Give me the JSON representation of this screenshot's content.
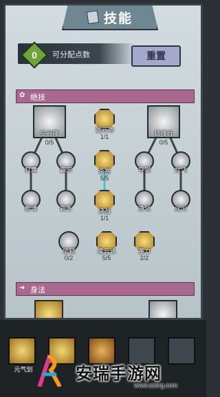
{
  "title": {
    "text": "技能",
    "icon": "scroll-icon"
  },
  "points": {
    "value": "0",
    "label": "可分配点数"
  },
  "reset_button": {
    "label": "重置"
  },
  "sections": {
    "ultimate": {
      "label": "绝技",
      "icon": "ultimate-icon"
    },
    "body": {
      "label": "身法",
      "icon": "body-icon"
    }
  },
  "skills": {
    "left_top": {
      "name": "空谷降",
      "count": "0/5"
    },
    "center_top": {
      "name": "混元功",
      "count": "1/1"
    },
    "right_top": {
      "name": "锁魂行",
      "count": "0/5"
    },
    "l_a": {
      "name": "打鹰"
    },
    "l_b": {
      "name": "霸宗"
    },
    "c_mid": {
      "name": "杀意",
      "count": "5/5"
    },
    "r_a": {
      "name": "夺钢"
    },
    "r_b": {
      "name": "灶飞"
    },
    "l_c": {
      "name": "断魂"
    },
    "l_d": {
      "name": "霜冬"
    },
    "c_low": {
      "name": "决战",
      "count": "1/1"
    },
    "r_c": {
      "name": "净化"
    },
    "r_d": {
      "name": "业火"
    },
    "b_left": {
      "name": "坚韧",
      "count": "0/2"
    },
    "b_mid": {
      "name": "凌云诀",
      "count": "5/5"
    },
    "b_right": {
      "name": "蕃力",
      "count": "2/2"
    }
  },
  "bottom_tabs": [
    {
      "label": "元气剑"
    }
  ],
  "watermark": {
    "text": "安瑞手游网",
    "url": "www.szerg.com"
  }
}
